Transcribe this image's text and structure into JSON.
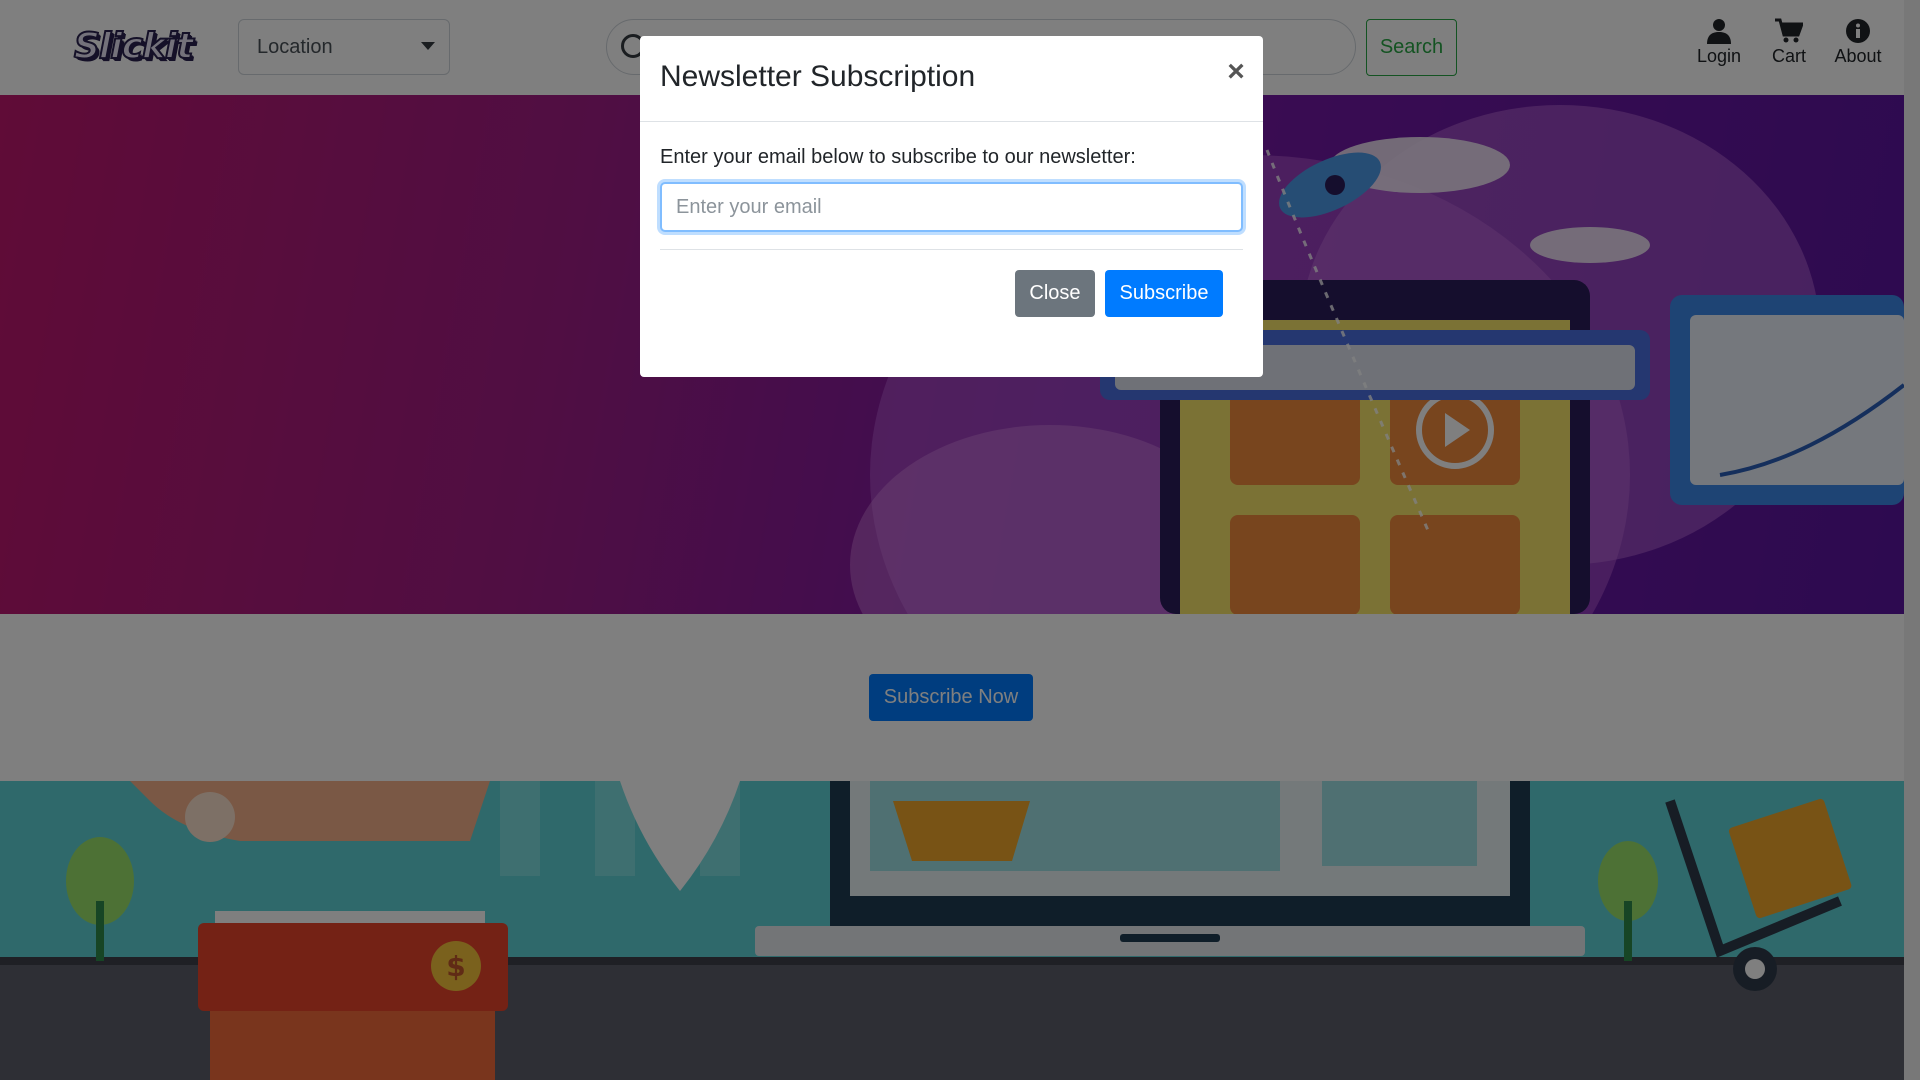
{
  "navbar": {
    "logo": "Slickit",
    "location": {
      "selected": "Location"
    },
    "search": {
      "placeholder": "",
      "button_label": "Search"
    },
    "items": [
      {
        "label": "Login",
        "icon": "user-icon"
      },
      {
        "label": "Cart",
        "icon": "cart-icon"
      },
      {
        "label": "About",
        "icon": "info-icon"
      }
    ]
  },
  "hero": {
    "illustration": "online-marketing-illustration"
  },
  "subscribe_section": {
    "button_label": "Subscribe Now"
  },
  "banner": {
    "illustration": "online-shopping-delivery-illustration"
  },
  "modal": {
    "title": "Newsletter Subscription",
    "close_symbol": "×",
    "prompt": "Enter your email below to subscribe to our newsletter:",
    "email_placeholder": "Enter your email",
    "email_value": "",
    "close_label": "Close",
    "subscribe_label": "Subscribe"
  },
  "colors": {
    "primary": "#007bff",
    "secondary": "#6c757d",
    "success": "#28a745",
    "hero_gradient_start": "#c0186e",
    "hero_gradient_end": "#5a15a0",
    "banner_teal": "#5fd3d6"
  }
}
